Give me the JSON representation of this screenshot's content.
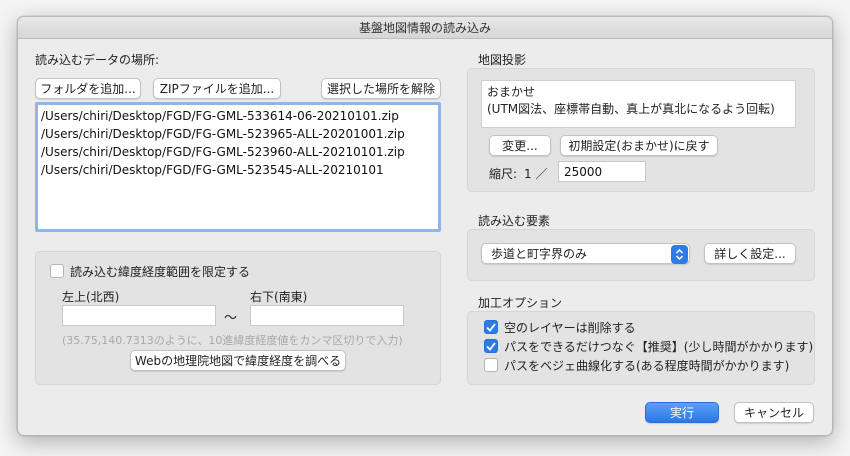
{
  "window": {
    "title": "基盤地図情報の読み込み"
  },
  "source": {
    "section_label": "読み込むデータの場所:",
    "add_folder": "フォルダを追加...",
    "add_zip": "ZIPファイルを追加...",
    "remove_selected": "選択した場所を解除",
    "files": [
      "/Users/chiri/Desktop/FGD/FG-GML-533614-06-20210101.zip",
      "/Users/chiri/Desktop/FGD/FG-GML-523965-ALL-20201001.zip",
      "/Users/chiri/Desktop/FGD/FG-GML-523960-ALL-20210101.zip",
      "/Users/chiri/Desktop/FGD/FG-GML-523545-ALL-20210101"
    ]
  },
  "range": {
    "limit_label": "読み込む緯度経度範囲を限定する",
    "limit_checked": false,
    "upper_left_label": "左上(北西)",
    "lower_right_label": "右下(南東)",
    "tilde": "〜",
    "upper_left_value": "",
    "lower_right_value": "",
    "hint": "(35.75,140.7313のように、10進緯度経度値をカンマ区切りで入力)",
    "web_lookup": "Webの地理院地図で緯度経度を調べる"
  },
  "projection": {
    "section_label": "地図投影",
    "line1": "おまかせ",
    "line2": "(UTM図法、座標帯自動、真上が真北になるよう回転)",
    "change": "変更...",
    "reset": "初期設定(おまかせ)に戻す",
    "scale_label": "縮尺:",
    "scale_prefix": "1 ／",
    "scale_value": "25000"
  },
  "elements": {
    "section_label": "読み込む要素",
    "selected": "歩道と町字界のみ",
    "details": "詳しく設定..."
  },
  "processing": {
    "section_label": "加工オプション",
    "options": [
      {
        "label": "空のレイヤーは削除する",
        "checked": true
      },
      {
        "label": "パスをできるだけつなぐ【推奨】(少し時間がかかります)",
        "checked": true
      },
      {
        "label": "パスをベジェ曲線化する(ある程度時間がかかります)",
        "checked": false
      }
    ]
  },
  "footer": {
    "ok": "実行",
    "cancel": "キャンセル"
  },
  "colors": {
    "accent": "#2d7ae8",
    "focus_ring": "#8db7ec",
    "panel": "#e3e3e3"
  }
}
